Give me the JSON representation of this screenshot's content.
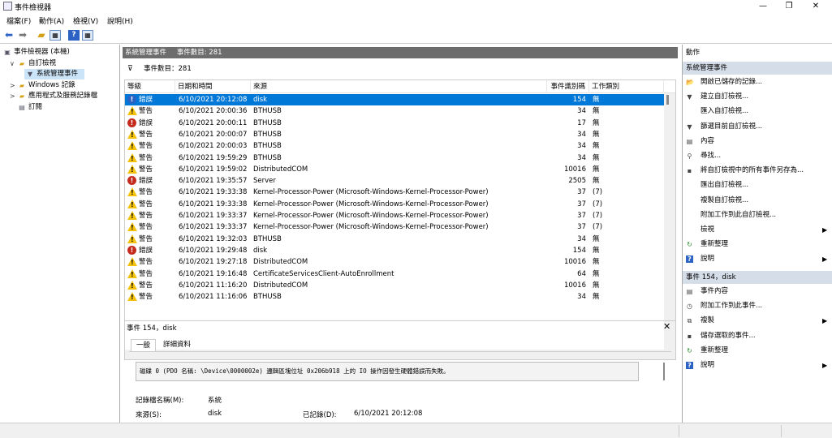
{
  "window": {
    "title": "事件檢視器",
    "controls": [
      "—",
      "❐",
      "✕"
    ]
  },
  "menu": [
    "檔案(F)",
    "動作(A)",
    "檢視(V)",
    "說明(H)"
  ],
  "tree": [
    {
      "label": "事件檢視器 (本機)",
      "indent": 0,
      "arrow": "",
      "icon": "computer-icon",
      "sym": "▣"
    },
    {
      "label": "自訂檢視",
      "indent": 1,
      "arrow": "∨",
      "icon": "folder-icon",
      "sym": "📁"
    },
    {
      "label": "系統管理事件",
      "indent": 2,
      "arrow": "",
      "icon": "filter-icon",
      "sym": "▼",
      "selected": true
    },
    {
      "label": "Windows 記錄",
      "indent": 1,
      "arrow": ">",
      "icon": "folder-icon",
      "sym": "📁"
    },
    {
      "label": "應用程式及服務記錄檔",
      "indent": 1,
      "arrow": ">",
      "icon": "folder-icon",
      "sym": "📁"
    },
    {
      "label": "訂閱",
      "indent": 1,
      "arrow": "",
      "icon": "subscription-icon",
      "sym": "▤"
    }
  ],
  "center": {
    "header_title": "系統管理事件",
    "header_count": "事件數目: 281",
    "filter_text": "事件數目：281",
    "columns": [
      "等級",
      "日期和時間",
      "來源",
      "事件識別碼",
      "工作類別"
    ],
    "rows": [
      {
        "level": "錯誤",
        "kind": "info",
        "date": "6/10/2021 20:12:08",
        "source": "disk",
        "id": "154",
        "task": "無",
        "selected": true
      },
      {
        "level": "警告",
        "kind": "warn",
        "date": "6/10/2021 20:00:36",
        "source": "BTHUSB",
        "id": "34",
        "task": "無"
      },
      {
        "level": "錯誤",
        "kind": "err",
        "date": "6/10/2021 20:00:11",
        "source": "BTHUSB",
        "id": "17",
        "task": "無"
      },
      {
        "level": "警告",
        "kind": "warn",
        "date": "6/10/2021 20:00:07",
        "source": "BTHUSB",
        "id": "34",
        "task": "無"
      },
      {
        "level": "警告",
        "kind": "warn",
        "date": "6/10/2021 20:00:03",
        "source": "BTHUSB",
        "id": "34",
        "task": "無"
      },
      {
        "level": "警告",
        "kind": "warn",
        "date": "6/10/2021 19:59:29",
        "source": "BTHUSB",
        "id": "34",
        "task": "無"
      },
      {
        "level": "警告",
        "kind": "warn",
        "date": "6/10/2021 19:59:02",
        "source": "DistributedCOM",
        "id": "10016",
        "task": "無"
      },
      {
        "level": "錯誤",
        "kind": "err",
        "date": "6/10/2021 19:35:57",
        "source": "Server",
        "id": "2505",
        "task": "無"
      },
      {
        "level": "警告",
        "kind": "warn",
        "date": "6/10/2021 19:33:38",
        "source": "Kernel-Processor-Power (Microsoft-Windows-Kernel-Processor-Power)",
        "id": "37",
        "task": "(7)"
      },
      {
        "level": "警告",
        "kind": "warn",
        "date": "6/10/2021 19:33:38",
        "source": "Kernel-Processor-Power (Microsoft-Windows-Kernel-Processor-Power)",
        "id": "37",
        "task": "(7)"
      },
      {
        "level": "警告",
        "kind": "warn",
        "date": "6/10/2021 19:33:37",
        "source": "Kernel-Processor-Power (Microsoft-Windows-Kernel-Processor-Power)",
        "id": "37",
        "task": "(7)"
      },
      {
        "level": "警告",
        "kind": "warn",
        "date": "6/10/2021 19:33:37",
        "source": "Kernel-Processor-Power (Microsoft-Windows-Kernel-Processor-Power)",
        "id": "37",
        "task": "(7)"
      },
      {
        "level": "警告",
        "kind": "warn",
        "date": "6/10/2021 19:32:03",
        "source": "BTHUSB",
        "id": "34",
        "task": "無"
      },
      {
        "level": "錯誤",
        "kind": "err",
        "date": "6/10/2021 19:29:48",
        "source": "disk",
        "id": "154",
        "task": "無"
      },
      {
        "level": "警告",
        "kind": "warn",
        "date": "6/10/2021 19:27:18",
        "source": "DistributedCOM",
        "id": "10016",
        "task": "無"
      },
      {
        "level": "警告",
        "kind": "warn",
        "date": "6/10/2021 19:16:48",
        "source": "CertificateServicesClient-AutoEnrollment",
        "id": "64",
        "task": "無"
      },
      {
        "level": "警告",
        "kind": "warn",
        "date": "6/10/2021 11:16:20",
        "source": "DistributedCOM",
        "id": "10016",
        "task": "無"
      },
      {
        "level": "警告",
        "kind": "warn",
        "date": "6/10/2021 11:16:06",
        "source": "BTHUSB",
        "id": "34",
        "task": "無"
      }
    ]
  },
  "detail": {
    "title": "事件 154，disk",
    "tabs": [
      "一般",
      "詳細資料"
    ],
    "message": "磁碟 0 (PDO 名稱: \\Device\\0000002e) 邏輯區塊位址 0x206b918 上的 IO 操作因發生硬體錯誤而失敗。",
    "log_name_label": "記錄檔名稱(M):",
    "log_name_value": "系統",
    "source_label": "來源(S):",
    "source_value": "disk",
    "logged_label": "已記錄(D):",
    "logged_value": "6/10/2021 20:12:08"
  },
  "actions": {
    "header": "動作",
    "section1": "系統管理事件",
    "items1": [
      {
        "label": "開啟已儲存的記錄...",
        "icon": "open-folder-icon",
        "sym": "📂"
      },
      {
        "label": "建立自訂檢視...",
        "icon": "filter-icon",
        "sym": "▼"
      },
      {
        "label": "匯入自訂檢視...",
        "icon": "blank-icon",
        "sym": ""
      },
      {
        "label": "篩選目前自訂檢視...",
        "icon": "filter-icon",
        "sym": "▼"
      },
      {
        "label": "內容",
        "icon": "properties-icon",
        "sym": "▤"
      },
      {
        "label": "尋找...",
        "icon": "binoculars-icon",
        "sym": "⚲"
      },
      {
        "label": "將自訂檢視中的所有事件另存為...",
        "icon": "save-icon",
        "sym": "▪"
      },
      {
        "label": "匯出自訂檢視...",
        "icon": "blank-icon",
        "sym": ""
      },
      {
        "label": "複製自訂檢視...",
        "icon": "blank-icon",
        "sym": ""
      },
      {
        "label": "附加工作到此自訂檢視...",
        "icon": "blank-icon",
        "sym": ""
      },
      {
        "label": "檢視",
        "icon": "blank-icon",
        "sym": "",
        "sub": true
      },
      {
        "label": "重新整理",
        "icon": "refresh-icon",
        "sym": "↻"
      },
      {
        "label": "說明",
        "icon": "help-icon",
        "sym": "?",
        "sub": true
      }
    ],
    "section2": "事件 154，disk",
    "items2": [
      {
        "label": "事件內容",
        "icon": "properties-icon",
        "sym": "▤"
      },
      {
        "label": "附加工作到此事件...",
        "icon": "task-icon",
        "sym": "◷"
      },
      {
        "label": "複製",
        "icon": "copy-icon",
        "sym": "⧉",
        "sub": true
      },
      {
        "label": "儲存選取的事件...",
        "icon": "save-icon",
        "sym": "▪"
      },
      {
        "label": "重新整理",
        "icon": "refresh-icon",
        "sym": "↻"
      },
      {
        "label": "說明",
        "icon": "help-icon",
        "sym": "?",
        "sub": true
      }
    ]
  }
}
